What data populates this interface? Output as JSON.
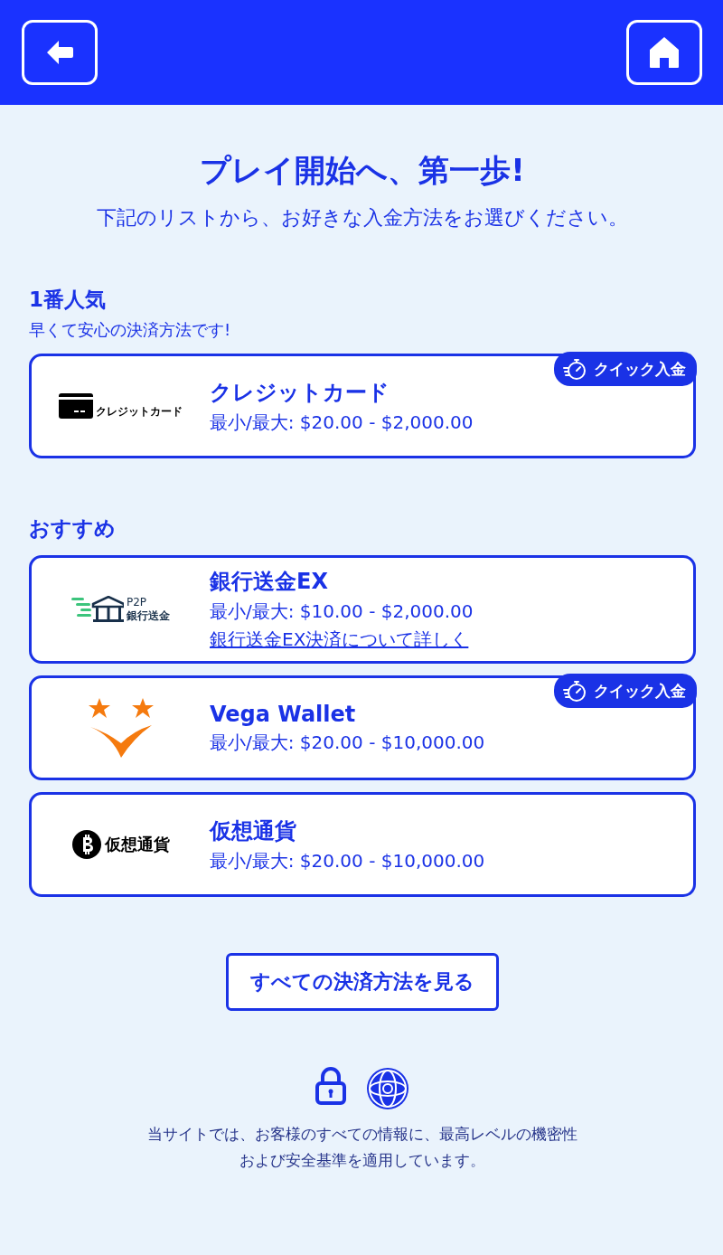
{
  "title": "プレイ開始へ、第一歩!",
  "subtitle": "下記のリストから、お好きな入金方法をお選びください。",
  "sections": [
    {
      "heading": "1番人気",
      "subheading": "早くて安心の決済方法です!",
      "methods": [
        {
          "name": "クレジットカード",
          "limits": "最小/最大: $20.00 - $2,000.00",
          "logo": {
            "kind": "card",
            "text": [
              "クレジットカード"
            ]
          },
          "badge": "クイック入金"
        }
      ]
    },
    {
      "heading": "おすすめ",
      "methods": [
        {
          "name": "銀行送金EX",
          "limits": "最小/最大: $10.00 - $2,000.00",
          "link": "銀行送金EX決済について詳しく",
          "logo": {
            "kind": "bank",
            "text": [
              "P2P",
              "銀行送金"
            ]
          }
        },
        {
          "name": "Vega Wallet",
          "limits": "最小/最大: $20.00 - $10,000.00",
          "logo": {
            "kind": "wallet"
          },
          "badge": "クイック入金"
        },
        {
          "name": "仮想通貨",
          "limits": "最小/最大: $20.00 - $10,000.00",
          "logo": {
            "kind": "crypto",
            "text": [
              "仮想通貨"
            ]
          }
        }
      ]
    }
  ],
  "all_methods_button": "すべての決済方法を見る",
  "security_note": [
    "当サイトでは、お客様のすべての情報に、最高レベルの機密性",
    "および安全基準を適用しています。"
  ]
}
